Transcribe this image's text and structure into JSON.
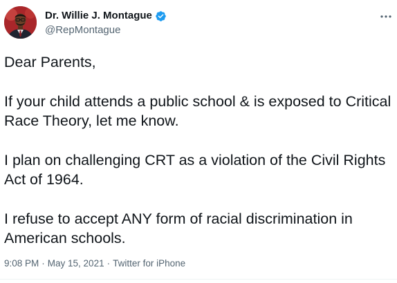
{
  "author": {
    "display_name": "Dr. Willie J. Montague",
    "handle": "@RepMontague",
    "verified": true
  },
  "tweet": {
    "paragraphs": [
      "Dear Parents,",
      "If your child attends a public school & is exposed to Critical Race Theory, let me know.",
      "I plan on challenging CRT as a violation of the Civil Rights Act of 1964.",
      "I refuse to accept ANY form of racial discrimination in American schools."
    ]
  },
  "meta": {
    "time": "9:08 PM",
    "separator": "·",
    "date": "May 15, 2021",
    "source": "Twitter for iPhone"
  },
  "icons": {
    "verified": "verified-badge-icon",
    "more": "more-options-icon"
  },
  "colors": {
    "verified_blue": "#1d9bf0",
    "text_primary": "#0f1419",
    "text_secondary": "#536471",
    "avatar_background": "#b3272b"
  }
}
